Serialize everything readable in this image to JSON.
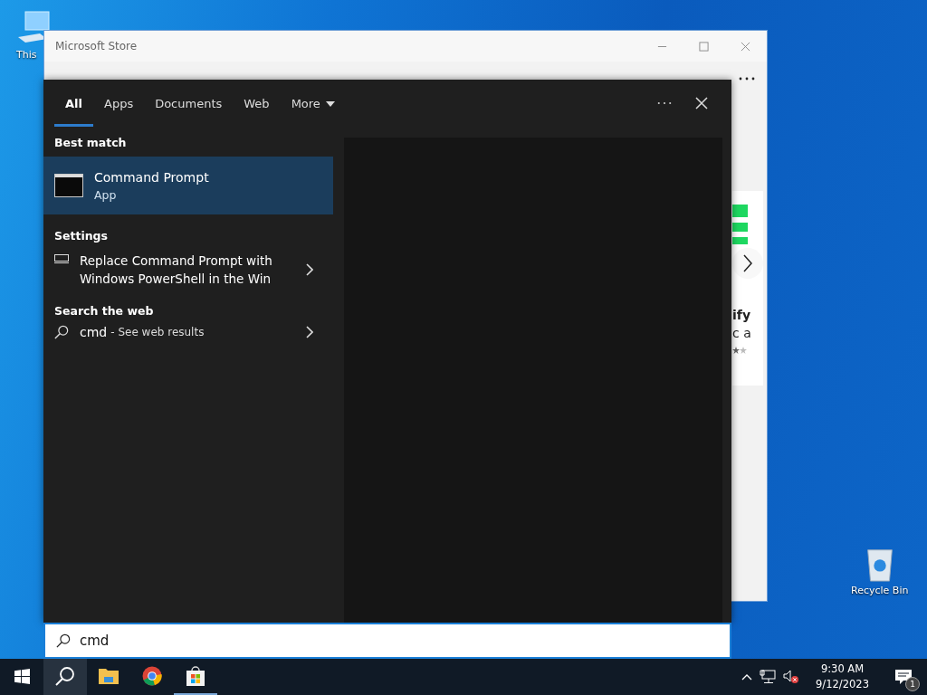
{
  "desktop_icons": [
    {
      "kind": "pc",
      "label": "This"
    },
    {
      "kind": "bin",
      "label": "Recycle Bin"
    }
  ],
  "store_window": {
    "title": "Microsoft Store",
    "card_lines": [
      "ify",
      "c a"
    ]
  },
  "search_panel": {
    "tabs": [
      {
        "label": "All",
        "selected": true,
        "kind": "tab"
      },
      {
        "label": "Apps",
        "selected": false,
        "kind": "tab"
      },
      {
        "label": "Documents",
        "selected": false,
        "kind": "tab"
      },
      {
        "label": "Web",
        "selected": false,
        "kind": "tab"
      },
      {
        "label": "More",
        "selected": false,
        "kind": "dropdown"
      }
    ],
    "sections": [
      {
        "heading": "Best match",
        "items": [
          {
            "kind": "app",
            "title": "Command Prompt",
            "subtitle": "App",
            "selected": true
          }
        ]
      },
      {
        "heading": "Settings",
        "items": [
          {
            "kind": "setting",
            "title": "Replace Command Prompt with Windows PowerShell in the Win",
            "selected": false
          }
        ]
      },
      {
        "heading": "Search the web",
        "items": [
          {
            "kind": "web",
            "title": "cmd",
            "subtitle": "- See web results",
            "selected": false
          }
        ]
      }
    ]
  },
  "search_box": {
    "value": "cmd"
  },
  "taskbar": {
    "apps": [
      {
        "kind": "start",
        "selected": false,
        "running": false
      },
      {
        "kind": "search",
        "selected": true,
        "running": false
      },
      {
        "kind": "files",
        "selected": false,
        "running": false
      },
      {
        "kind": "browser",
        "selected": false,
        "running": false
      },
      {
        "kind": "store",
        "selected": false,
        "running": true
      }
    ],
    "time": "9:30 AM",
    "date": "9/12/2023",
    "notifications": "1"
  }
}
